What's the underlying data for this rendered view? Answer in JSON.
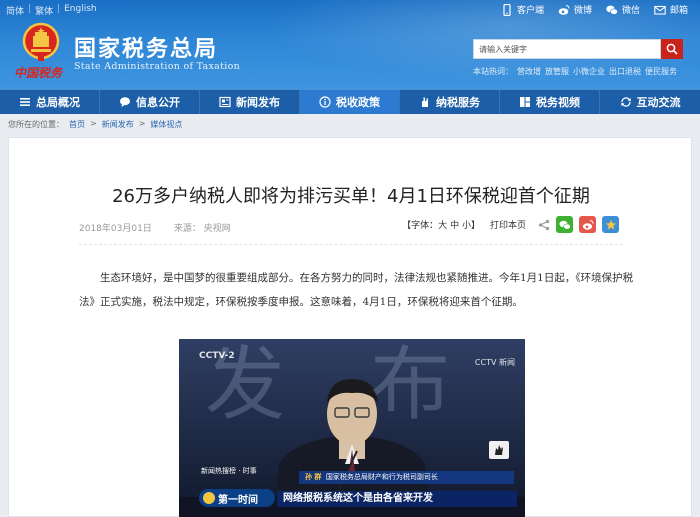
{
  "lang": [
    "简体",
    "繁体",
    "English"
  ],
  "topbar": [
    {
      "icon": "phone-icon",
      "label": "客户端"
    },
    {
      "icon": "weibo-icon",
      "label": "微博"
    },
    {
      "icon": "wechat-icon",
      "label": "微信"
    },
    {
      "icon": "mail-icon",
      "label": "邮箱"
    }
  ],
  "logo": {
    "cn_tax_text": "中国税务",
    "name_cn": "国家税务总局",
    "name_en": "State Administration of Taxation"
  },
  "search": {
    "placeholder": "请输入关键字",
    "quick_links": [
      "本站热词：",
      "营改增",
      "放管服",
      "小微企业",
      "出口退税",
      "便民服务"
    ]
  },
  "nav": [
    {
      "icon": "menu-icon",
      "label": "总局概况",
      "active": false
    },
    {
      "icon": "chat-icon",
      "label": "信息公开",
      "active": false
    },
    {
      "icon": "newspaper-icon",
      "label": "新闻发布",
      "active": false
    },
    {
      "icon": "info-icon",
      "label": "税收政策",
      "active": true
    },
    {
      "icon": "hand-icon",
      "label": "纳税服务",
      "active": false
    },
    {
      "icon": "video-icon",
      "label": "税务视频",
      "active": false
    },
    {
      "icon": "exchange-icon",
      "label": "互动交流",
      "active": false
    }
  ],
  "breadcrumb": {
    "prefix": "您所在的位置：",
    "items": [
      "首页",
      "新闻发布",
      "媒体视点"
    ],
    "separator": ">"
  },
  "article": {
    "title": "26万多户纳税人即将为排污买单！4月1日环保税迎首个征期",
    "date": "2018年03月01日",
    "source_label": "来源：",
    "source": "央视网",
    "font_label": "【字体：",
    "font_sizes": [
      "大",
      "中",
      "小"
    ],
    "font_close": "】",
    "print_label": "打印本页",
    "paragraph": "生态环境好，是中国梦的很重要组成部分。在各方努力的同时，法律法规也紧随推进。今年1月1日起，《环境保护税法》正式实施，税法中规定，环保税按季度申报。这意味着，4月1日，环保税将迎来首个征期。"
  },
  "video": {
    "channel_top": "CCTV-2",
    "channel_right": "CCTV 新闻",
    "bg_text": "发 布 会",
    "speaker_name": "孙   群",
    "speaker_title": "国家税务总局财产和行为税司副司长",
    "program_tag": "新闻热搜榜 · 时事",
    "program_name": "第一时间",
    "caption": "网络报税系统这个是由各省来开发"
  },
  "colors": {
    "header_blue": "#2e86d6",
    "nav_blue": "#1c5ea8",
    "nav_active": "#2d7bd0",
    "search_red": "#c9241c",
    "link_blue": "#2b66b1"
  }
}
